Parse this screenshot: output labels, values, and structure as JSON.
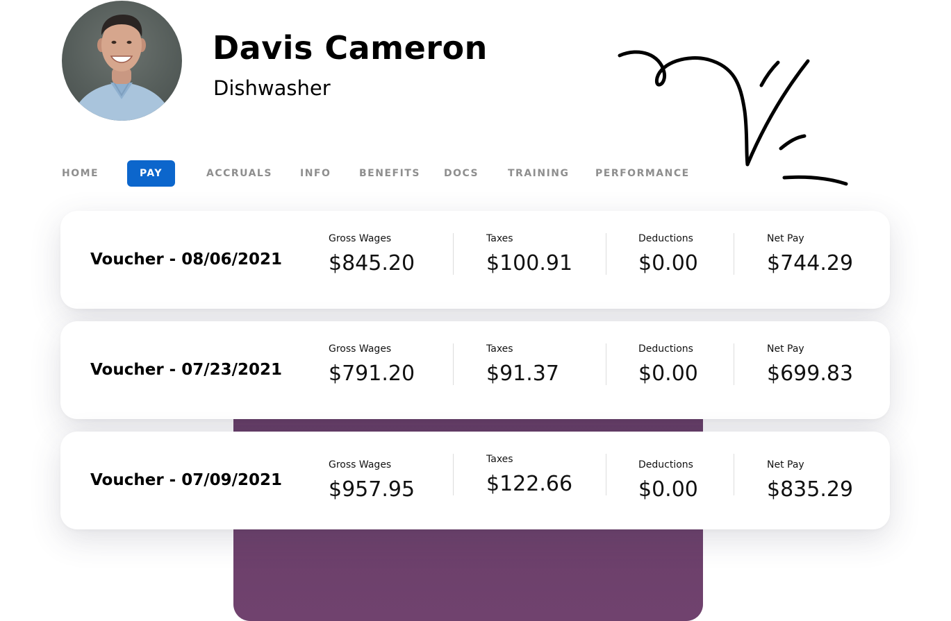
{
  "profile": {
    "name": "Davis Cameron",
    "role": "Dishwasher"
  },
  "tabs": [
    {
      "label": "HOME",
      "active": false
    },
    {
      "label": "PAY",
      "active": true
    },
    {
      "label": "ACCRUALS",
      "active": false
    },
    {
      "label": "INFO",
      "active": false
    },
    {
      "label": "BENEFITS",
      "active": false
    },
    {
      "label": "DOCS",
      "active": false
    },
    {
      "label": "TRAINING",
      "active": false
    },
    {
      "label": "PERFORMANCE",
      "active": false
    }
  ],
  "columns": {
    "gross": "Gross Wages",
    "taxes": "Taxes",
    "deductions": "Deductions",
    "net": "Net Pay"
  },
  "vouchers": [
    {
      "title": "Voucher - 08/06/2021",
      "gross": "$845.20",
      "taxes": "$100.91",
      "deductions": "$0.00",
      "net": "$744.29"
    },
    {
      "title": "Voucher - 07/23/2021",
      "gross": "$791.20",
      "taxes": "$91.37",
      "deductions": "$0.00",
      "net": "$699.83"
    },
    {
      "title": "Voucher - 07/09/2021",
      "gross": "$957.95",
      "taxes": "$122.66",
      "deductions": "$0.00",
      "net": "$835.29"
    }
  ],
  "colors": {
    "accent": "#0c66cc",
    "panel": "#6b3f6b",
    "tab_inactive": "#8e8e8e"
  },
  "icons": {
    "avatar": "profile-photo",
    "signature": "signature-scribble"
  }
}
